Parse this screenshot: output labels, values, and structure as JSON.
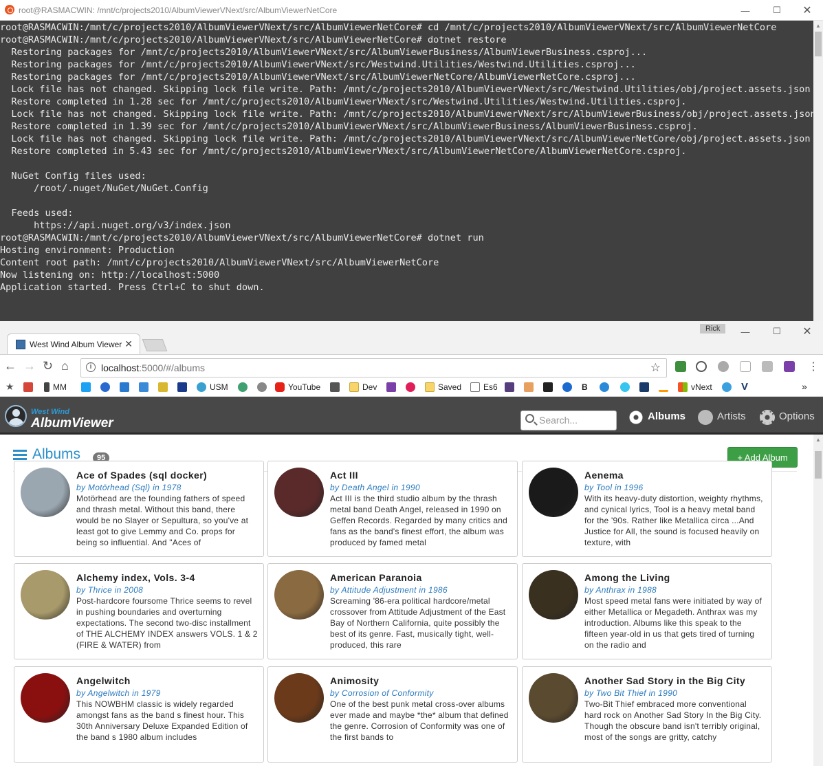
{
  "terminal": {
    "title": "root@RASMACWIN: /mnt/c/projects2010/AlbumViewerVNext/src/AlbumViewerNetCore",
    "lines": [
      "root@RASMACWIN:/mnt/c/projects2010/AlbumViewerVNext/src/AlbumViewerNetCore# cd /mnt/c/projects2010/AlbumViewerVNext/src/AlbumViewerNetCore",
      "root@RASMACWIN:/mnt/c/projects2010/AlbumViewerVNext/src/AlbumViewerNetCore# dotnet restore",
      "  Restoring packages for /mnt/c/projects2010/AlbumViewerVNext/src/AlbumViewerBusiness/AlbumViewerBusiness.csproj...",
      "  Restoring packages for /mnt/c/projects2010/AlbumViewerVNext/src/Westwind.Utilities/Westwind.Utilities.csproj...",
      "  Restoring packages for /mnt/c/projects2010/AlbumViewerVNext/src/AlbumViewerNetCore/AlbumViewerNetCore.csproj...",
      "  Lock file has not changed. Skipping lock file write. Path: /mnt/c/projects2010/AlbumViewerVNext/src/Westwind.Utilities/obj/project.assets.json",
      "  Restore completed in 1.28 sec for /mnt/c/projects2010/AlbumViewerVNext/src/Westwind.Utilities/Westwind.Utilities.csproj.",
      "  Lock file has not changed. Skipping lock file write. Path: /mnt/c/projects2010/AlbumViewerVNext/src/AlbumViewerBusiness/obj/project.assets.json",
      "  Restore completed in 1.39 sec for /mnt/c/projects2010/AlbumViewerVNext/src/AlbumViewerBusiness/AlbumViewerBusiness.csproj.",
      "  Lock file has not changed. Skipping lock file write. Path: /mnt/c/projects2010/AlbumViewerVNext/src/AlbumViewerNetCore/obj/project.assets.json",
      "  Restore completed in 5.43 sec for /mnt/c/projects2010/AlbumViewerVNext/src/AlbumViewerNetCore/AlbumViewerNetCore.csproj.",
      "",
      "  NuGet Config files used:",
      "      /root/.nuget/NuGet/NuGet.Config",
      "",
      "  Feeds used:",
      "      https://api.nuget.org/v3/index.json",
      "root@RASMACWIN:/mnt/c/projects2010/AlbumViewerVNext/src/AlbumViewerNetCore# dotnet run",
      "Hosting environment: Production",
      "Content root path: /mnt/c/projects2010/AlbumViewerVNext/src/AlbumViewerNetCore",
      "Now listening on: http://localhost:5000",
      "Application started. Press Ctrl+C to shut down."
    ]
  },
  "browser": {
    "tab_title": "West Wind Album Viewer",
    "profile": "Rick",
    "url_host": "localhost",
    "url_rest": ":5000/#/albums",
    "bookmarks": [
      "MM",
      "USM",
      "YouTube",
      "Dev",
      "Saved",
      "Es6",
      "B",
      "vNext"
    ]
  },
  "app": {
    "logo_small": "West Wind",
    "logo_main": "AlbumViewer",
    "search_placeholder": "Search...",
    "nav": {
      "albums": "Albums",
      "artists": "Artists",
      "options": "Options"
    },
    "page_title": "Albums",
    "album_count": "95",
    "add_button": "+ Add Album",
    "albums": [
      {
        "title": "Ace of Spades (sql docker)",
        "by": "by Motörhead (Sql) in 1978",
        "desc": "Motörhead are the founding fathers of speed and thrash metal. Without this band, there would be no Slayer or Sepultura, so you've at least got to give Lemmy and Co. props for being so influential. And \"Aces of",
        "color": "#9aa6b0"
      },
      {
        "title": "Act III",
        "by": "by Death Angel in 1990",
        "desc": "Act III is the third studio album by the thrash metal band Death Angel, released in 1990 on Geffen Records. Regarded by many critics and fans as the band's finest effort, the album was produced by famed metal",
        "color": "#5a2a2a"
      },
      {
        "title": "Aenema",
        "by": "by Tool in 1996",
        "desc": "With its heavy-duty distortion, weighty rhythms, and cynical lyrics, Tool is a heavy metal band for the '90s. Rather like Metallica circa ...And Justice for All, the sound is focused heavily on texture, with",
        "color": "#1a1a1a"
      },
      {
        "title": "Alchemy index, Vols. 3-4",
        "by": "by Thrice in 2008",
        "desc": "Post-hardcore foursome Thrice seems to revel in pushing boundaries and overturning expectations. The second two-disc installment of THE ALCHEMY INDEX answers VOLS. 1 & 2 (FIRE & WATER) from",
        "color": "#a89a6a"
      },
      {
        "title": "American Paranoia",
        "by": "by Attitude Adjustment in 1986",
        "desc": "Screaming '86-era political hardcore/metal crossover from Attitude Adjustment of the East Bay of Northern California, quite possibly the best of its genre. Fast, musically tight, well-produced, this rare",
        "color": "#8a6a40"
      },
      {
        "title": "Among the Living",
        "by": "by Anthrax in 1988",
        "desc": "Most speed metal fans were initiated by way of either Metallica or Megadeth. Anthrax was my introduction. Albums like this speak to the fifteen year-old in us that gets tired of turning on the radio and",
        "color": "#3a3020"
      },
      {
        "title": "Angelwitch",
        "by": "by Angelwitch in 1979",
        "desc": "This NOWBHM classic is widely regarded amongst fans as the band s finest hour. This 30th Anniversary Deluxe Expanded Edition of the band s 1980 album includes",
        "color": "#8a1010"
      },
      {
        "title": "Animosity",
        "by": "by Corrosion of Conformity",
        "desc": "One of the best punk metal cross-over albums ever made and maybe *the* album that defined the genre.  Corrosion of Conformity was one of the first bands to",
        "color": "#6a3a1a"
      },
      {
        "title": "Another Sad Story in the Big City",
        "by": "by Two Bit Thief in 1990",
        "desc": "Two-Bit Thief embraced more conventional hard rock on Another Sad Story In the Big City. Though the obscure band isn't terribly original, most of the songs are gritty, catchy",
        "color": "#5a4a30"
      }
    ]
  }
}
